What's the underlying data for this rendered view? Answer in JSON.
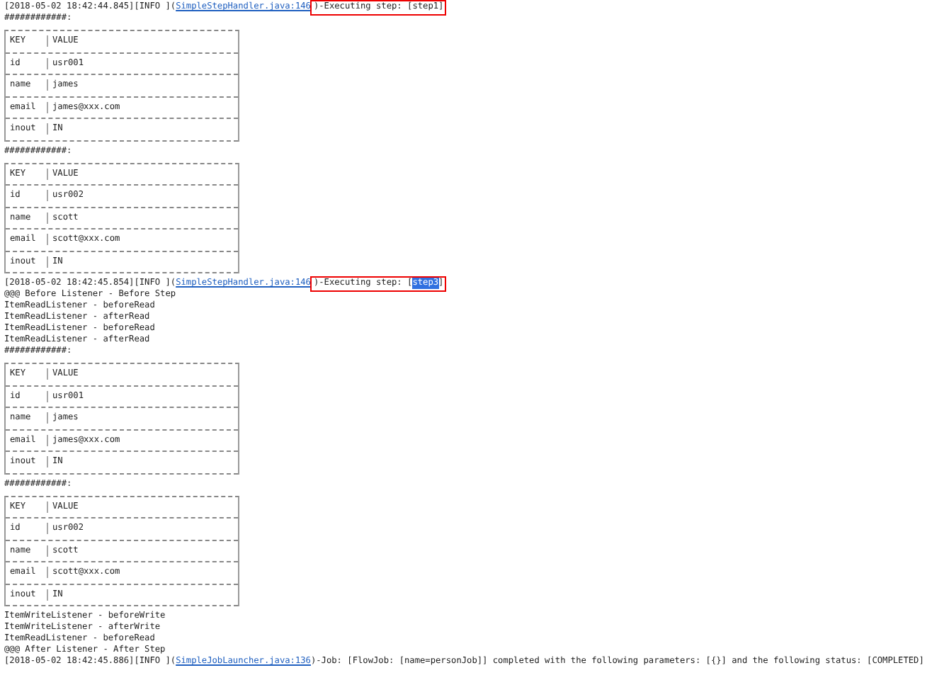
{
  "blocks": [
    {
      "kind": "log",
      "timestamp": "[2018-05-02 18:42:44.845]",
      "level": "[INFO ]",
      "open": "(",
      "source": "SimpleStepHandler.java:146",
      "close": ")",
      "boxed": true,
      "message": "-Executing step: [",
      "step": {
        "text": "step1",
        "selected": false
      },
      "end": "]"
    },
    {
      "kind": "text",
      "text": "############:"
    },
    {
      "kind": "table",
      "rows": [
        {
          "key": "KEY",
          "value": "VALUE"
        },
        {
          "key": "id",
          "value": "usr001"
        },
        {
          "key": "name",
          "value": "james"
        },
        {
          "key": "email",
          "value": "james@xxx.com"
        },
        {
          "key": "inout",
          "value": "IN"
        }
      ]
    },
    {
      "kind": "text",
      "text": "############:"
    },
    {
      "kind": "table",
      "rows": [
        {
          "key": "KEY",
          "value": "VALUE"
        },
        {
          "key": "id",
          "value": "usr002"
        },
        {
          "key": "name",
          "value": "scott"
        },
        {
          "key": "email",
          "value": "scott@xxx.com"
        },
        {
          "key": "inout",
          "value": "IN"
        }
      ]
    },
    {
      "kind": "log",
      "timestamp": "[2018-05-02 18:42:45.854]",
      "level": "[INFO ]",
      "open": "(",
      "source": "SimpleStepHandler.java:146",
      "close": ")",
      "boxed": true,
      "message": "-Executing step: [",
      "step": {
        "text": "step3",
        "selected": true
      },
      "end": "]"
    },
    {
      "kind": "text",
      "text": "@@@ Before Listener - Before Step"
    },
    {
      "kind": "text",
      "text": "ItemReadListener - beforeRead"
    },
    {
      "kind": "text",
      "text": "ItemReadListener - afterRead"
    },
    {
      "kind": "text",
      "text": "ItemReadListener - beforeRead"
    },
    {
      "kind": "text",
      "text": "ItemReadListener - afterRead"
    },
    {
      "kind": "text",
      "text": "############:"
    },
    {
      "kind": "table",
      "rows": [
        {
          "key": "KEY",
          "value": "VALUE"
        },
        {
          "key": "id",
          "value": "usr001"
        },
        {
          "key": "name",
          "value": "james"
        },
        {
          "key": "email",
          "value": "james@xxx.com"
        },
        {
          "key": "inout",
          "value": "IN"
        }
      ]
    },
    {
      "kind": "text",
      "text": "############:"
    },
    {
      "kind": "table",
      "rows": [
        {
          "key": "KEY",
          "value": "VALUE"
        },
        {
          "key": "id",
          "value": "usr002"
        },
        {
          "key": "name",
          "value": "scott"
        },
        {
          "key": "email",
          "value": "scott@xxx.com"
        },
        {
          "key": "inout",
          "value": "IN"
        }
      ]
    },
    {
      "kind": "text",
      "text": "ItemWriteListener - beforeWrite"
    },
    {
      "kind": "text",
      "text": "ItemWriteListener - afterWrite"
    },
    {
      "kind": "text",
      "text": "ItemReadListener - beforeRead"
    },
    {
      "kind": "text",
      "text": "@@@ After Listener - After Step"
    },
    {
      "kind": "log",
      "timestamp": "[2018-05-02 18:42:45.886]",
      "level": "[INFO ]",
      "open": "(",
      "source": "SimpleJobLauncher.java:136",
      "close": ")",
      "boxed": false,
      "message": "-Job: [FlowJob: [name=personJob]] completed with the following parameters: [{}] and the following status: [COMPLETED]"
    }
  ]
}
